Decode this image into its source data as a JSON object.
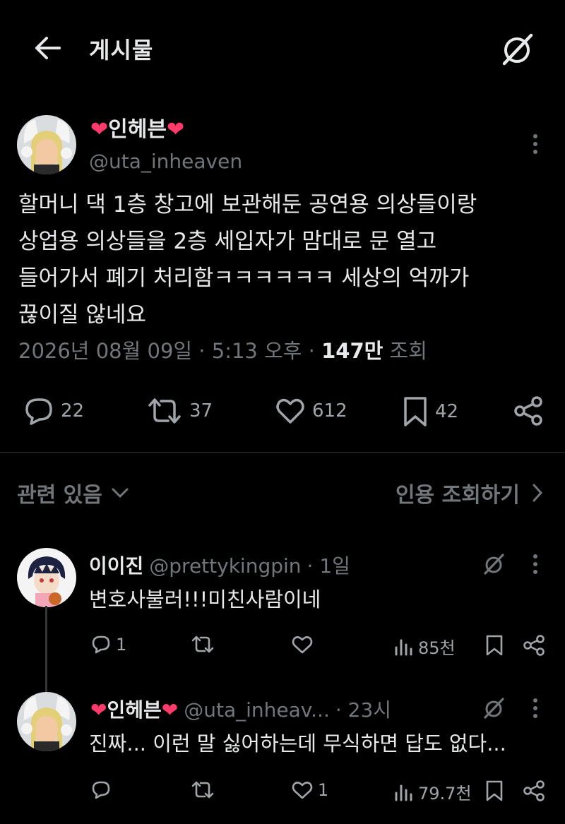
{
  "header": {
    "title": "게시물",
    "back_icon": "arrow-left-icon",
    "grok_icon": "grok-icon"
  },
  "post": {
    "author_name": "인헤븐",
    "name_decoration_icon": "heart-emoji-icon",
    "handle": "@uta_inheaven",
    "text_lines": [
      "할머니 댁 1층 창고에 보관해둔 공연용 의상들이랑",
      "상업용 의상들을 2층 세입자가 맘대로 문 열고",
      "들어가서 폐기 처리함ㅋㅋㅋㅋㅋㅋ 세상의 억까가",
      "끊이질 않네요"
    ],
    "meta_date": "2026년 08월 09일 · 5:13 오후 · ",
    "views_count": "147만",
    "views_label": "조회",
    "actions": {
      "replies": "22",
      "reposts": "37",
      "likes": "612",
      "bookmarks": "42"
    }
  },
  "related": {
    "label": "관련 있음",
    "quotes_label": "인용 조회하기"
  },
  "replies": [
    {
      "name": "이이진",
      "handle": "@prettykingpin",
      "time": "· 1일",
      "text": "변호사불러!!!미친사람이네",
      "replies": "1",
      "reposts": "",
      "likes": "",
      "views": "85천"
    },
    {
      "name": "인헤븐",
      "handle": "@uta_inheav...",
      "time": "· 23시",
      "text": "진짜... 이런 말 싫어하는데 무식하면 답도 없다...",
      "replies": "",
      "reposts": "",
      "likes": "1",
      "views": "79.7천"
    }
  ],
  "colors": {
    "background": "#000000",
    "text": "#e7e9ea",
    "muted": "#71767b",
    "heart": "#ff3b6b"
  }
}
